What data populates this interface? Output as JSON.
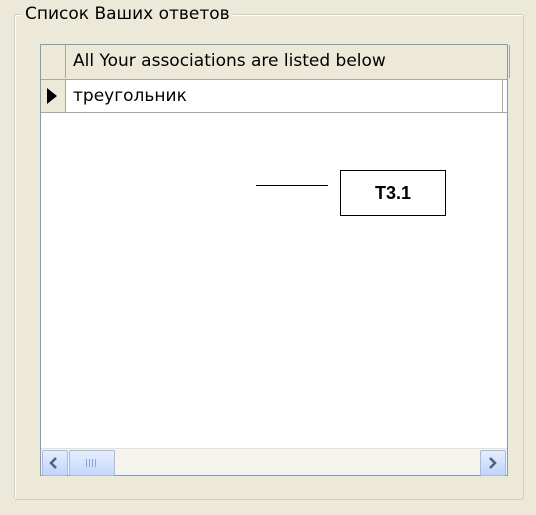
{
  "groupbox": {
    "title": "Список Ваших ответов"
  },
  "grid": {
    "column_header": "All Your associations are listed below",
    "rows": [
      {
        "value": "треугольник",
        "current": true
      }
    ]
  },
  "callout": {
    "label": "T3.1"
  },
  "scrollbar": {
    "left_icon": "arrow-left-icon",
    "right_icon": "arrow-right-icon"
  }
}
